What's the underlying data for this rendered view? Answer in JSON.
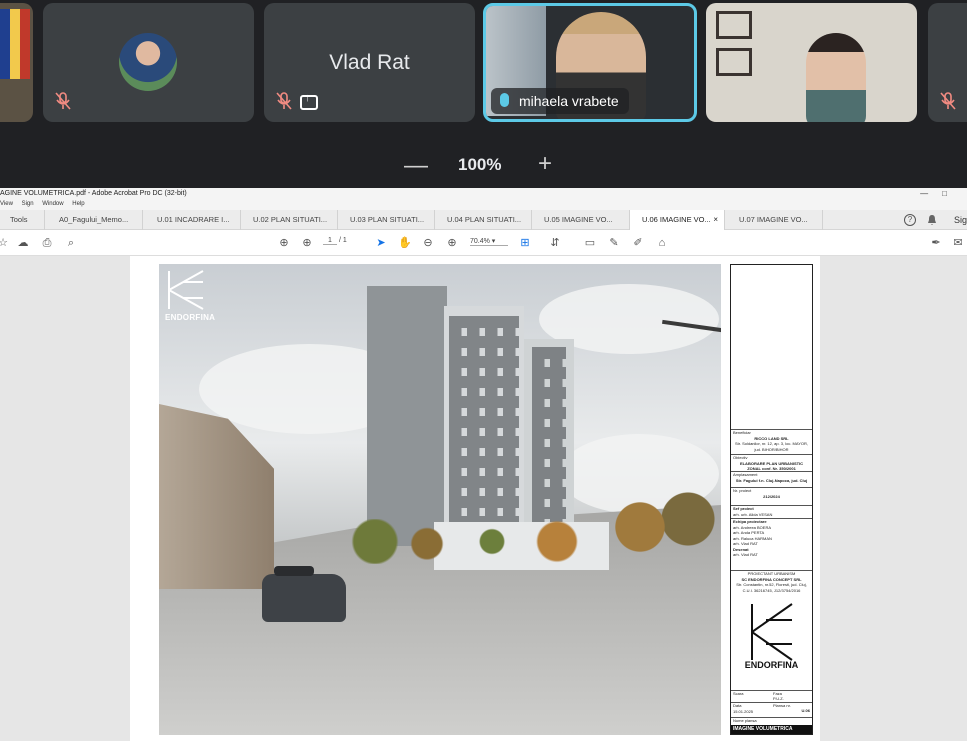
{
  "meet": {
    "participants": [
      {
        "name": "",
        "muted": false
      },
      {
        "name": "",
        "muted": true
      },
      {
        "name": "Vlad Rat",
        "muted": true,
        "presenting": true
      },
      {
        "name": "mihaela vrabete",
        "muted": false,
        "speaking": true
      },
      {
        "name": "",
        "muted": false
      },
      {
        "name": "",
        "muted": true
      }
    ],
    "zoom": {
      "minus": "—",
      "value": "100%",
      "plus": "+"
    },
    "colors": {
      "speaking_border": "#5cc9e6",
      "tile_bg": "#3c4043",
      "muted_icon": "#f28b82"
    }
  },
  "acrobat": {
    "title": "AGINE VOLUMETRICA.pdf - Adobe Acrobat Pro DC (32-bit)",
    "window_controls": [
      "—",
      "□"
    ],
    "menu": [
      "View",
      "Sign",
      "Window",
      "Help"
    ],
    "tabs": [
      {
        "label": "Tools"
      },
      {
        "label": "A0_Fagului_Memo..."
      },
      {
        "label": "U.01 INCADRARE I..."
      },
      {
        "label": "U.02 PLAN SITUATI..."
      },
      {
        "label": "U.03 PLAN SITUATI..."
      },
      {
        "label": "U.04 PLAN SITUATI..."
      },
      {
        "label": "U.05 IMAGINE VO..."
      },
      {
        "label": "U.06 IMAGINE VO...",
        "active": true
      },
      {
        "label": "U.07 IMAGINE VO..."
      }
    ],
    "tab_close": "×",
    "help_icon": "?",
    "sign_label": "Sig",
    "toolbar": {
      "page_current": "1",
      "page_total": "/ 1",
      "zoom": "70.4%"
    }
  },
  "drawing": {
    "logo_text": "ENDORFINA",
    "title_block": {
      "beneficiar_label": "Beneficiar",
      "beneficiar": "RICCO LAND SRL",
      "beneficiar_addr": "Str. Soldanilor, nr. 12, ap. 3, loc. MAYOR, jud. BIHOR/BIHOR",
      "obiectiv_label": "Obiectiv",
      "obiectiv": "ELABORARE PLAN URBANISTIC ZONAL conf. Nr. 350/2001",
      "amplasament_label": "Amplasament",
      "amplasament": "Str. Fagului f.n. Cluj-Napoca, jud. Cluj",
      "nr_proiect_label": "Nr. proiect",
      "nr_proiect": "212/2024",
      "sef_proiect_label": "Sef proiect",
      "sef_proiect": "arh. urb. Alida VESAN",
      "echipa_label": "Echipa proiectare",
      "echipa_1": "arh. Andreea BOERA",
      "echipa_2": "arh. Anda PERTA",
      "echipa_3": "arh. Raluca HARMAN",
      "echipa_4": "arh. Vlad RAT",
      "desenat_label": "Desenat",
      "desenat": "arh. Vlad RAT",
      "firm_label": "PROIECTANT URBANISM",
      "firm": "SC ENDORFINA CONCEPT SRL",
      "firm_addr": "Str. Constantin, nr.52, Floresti, jud. Cluj, C.U.I. 36216745, J12/3754/2016",
      "firm_logo_text": "ENDORFINA",
      "scara_label": "Scara",
      "scara": "Faza",
      "scara_val": "P.U.Z.",
      "data_label": "Data",
      "data_val": "15.01.2025",
      "plansa_label": "Plansa nr.",
      "plansa": "U.06",
      "nume_label": "Nume plansa",
      "nume": "IMAGINE VOLUMETRICA"
    }
  }
}
